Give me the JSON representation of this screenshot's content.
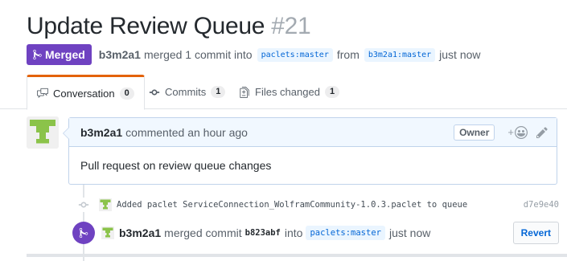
{
  "pr": {
    "title": "Update Review Queue",
    "number": "#21",
    "state_label": "Merged",
    "author": "b3m2a1",
    "merge_text": "merged 1 commit into",
    "base_branch": "paclets:master",
    "from_text": "from",
    "head_branch": "b3m2a1:master",
    "time": "just now"
  },
  "tabs": [
    {
      "label": "Conversation",
      "count": "0",
      "icon": "comment-discussion-icon"
    },
    {
      "label": "Commits",
      "count": "1",
      "icon": "git-commit-icon"
    },
    {
      "label": "Files changed",
      "count": "1",
      "icon": "file-diff-icon"
    }
  ],
  "comment": {
    "author": "b3m2a1",
    "action": "commented an hour ago",
    "role_badge": "Owner",
    "reaction_label": "+",
    "body": "Pull request on review queue changes"
  },
  "commit": {
    "message": "Added paclet ServiceConnection_WolframCommunity-1.0.3.paclet to queue",
    "sha": "d7e9e40"
  },
  "merge_event": {
    "author": "b3m2a1",
    "text": "merged commit",
    "sha": "b823abf",
    "into": "into",
    "branch": "paclets:master",
    "time": "just now",
    "revert_label": "Revert"
  },
  "colors": {
    "merged_purple": "#6f42c1",
    "link_blue": "#0366d6",
    "active_tab_accent": "#e36209",
    "comment_header_bg": "#f1f8ff",
    "avatar_green": "#8bc34a"
  }
}
